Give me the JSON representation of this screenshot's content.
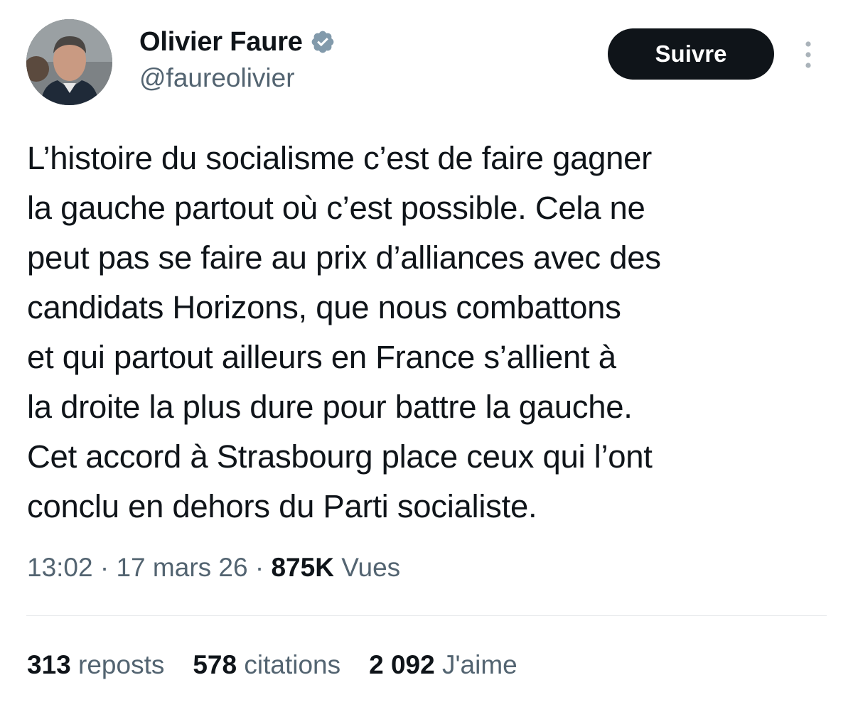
{
  "author": {
    "display_name": "Olivier Faure",
    "handle": "@faureolivier",
    "verified": true
  },
  "follow_button": {
    "label": "Suivre"
  },
  "tweet": {
    "lines": [
      "L’histoire du socialisme c’est de faire gagner",
      "la gauche partout où c’est possible. Cela ne",
      "peut pas se faire au prix d’alliances avec des",
      "candidats Horizons, que nous combattons",
      "et qui partout ailleurs en France s’allient à",
      "la droite la plus dure pour battre la gauche.",
      "Cet accord à Strasbourg place ceux qui l’ont",
      "conclu en dehors du Parti socialiste."
    ]
  },
  "meta": {
    "time": "13:02",
    "separator": "·",
    "date": "17 mars 26",
    "views_count": "875K",
    "views_label": "Vues"
  },
  "stats": {
    "reposts_count": "313",
    "reposts_label": "reposts",
    "quotes_count": "578",
    "quotes_label": "citations",
    "likes_count": "2 092",
    "likes_label": "J'aime"
  },
  "colors": {
    "text": "#0f1419",
    "secondary": "#536471",
    "verified": "#829aab",
    "button_bg": "#0f1419",
    "divider": "#e6e9eb"
  },
  "icons": {
    "verified": "verified-badge-icon",
    "more": "more-vertical-icon"
  }
}
